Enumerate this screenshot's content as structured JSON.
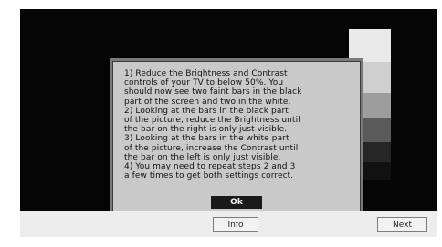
{
  "dialog": {
    "instructions": "1) Reduce the Brightness and Contrast\ncontrols of your TV to below 50%. You\nshould now see two faint bars in the black\npart of the screen and two in the white.\n2) Looking at the bars in the black part\nof the picture, reduce the Brightness until\nthe bar on the right is only just visible.\n3) Looking at the bars in the white part\nof the picture, increase the Contrast until\nthe bar on the left is only just visible.\n4) You may need to repeat steps 2 and 3\na few times to get both settings correct.",
    "ok_label": "Ok"
  },
  "bottom_bar": {
    "info_label": "Info",
    "next_label": "Next"
  },
  "colors": {
    "screen_background": "#050505",
    "dialog_background": "#c9c9c9",
    "ok_button": "#1a1a1a"
  }
}
